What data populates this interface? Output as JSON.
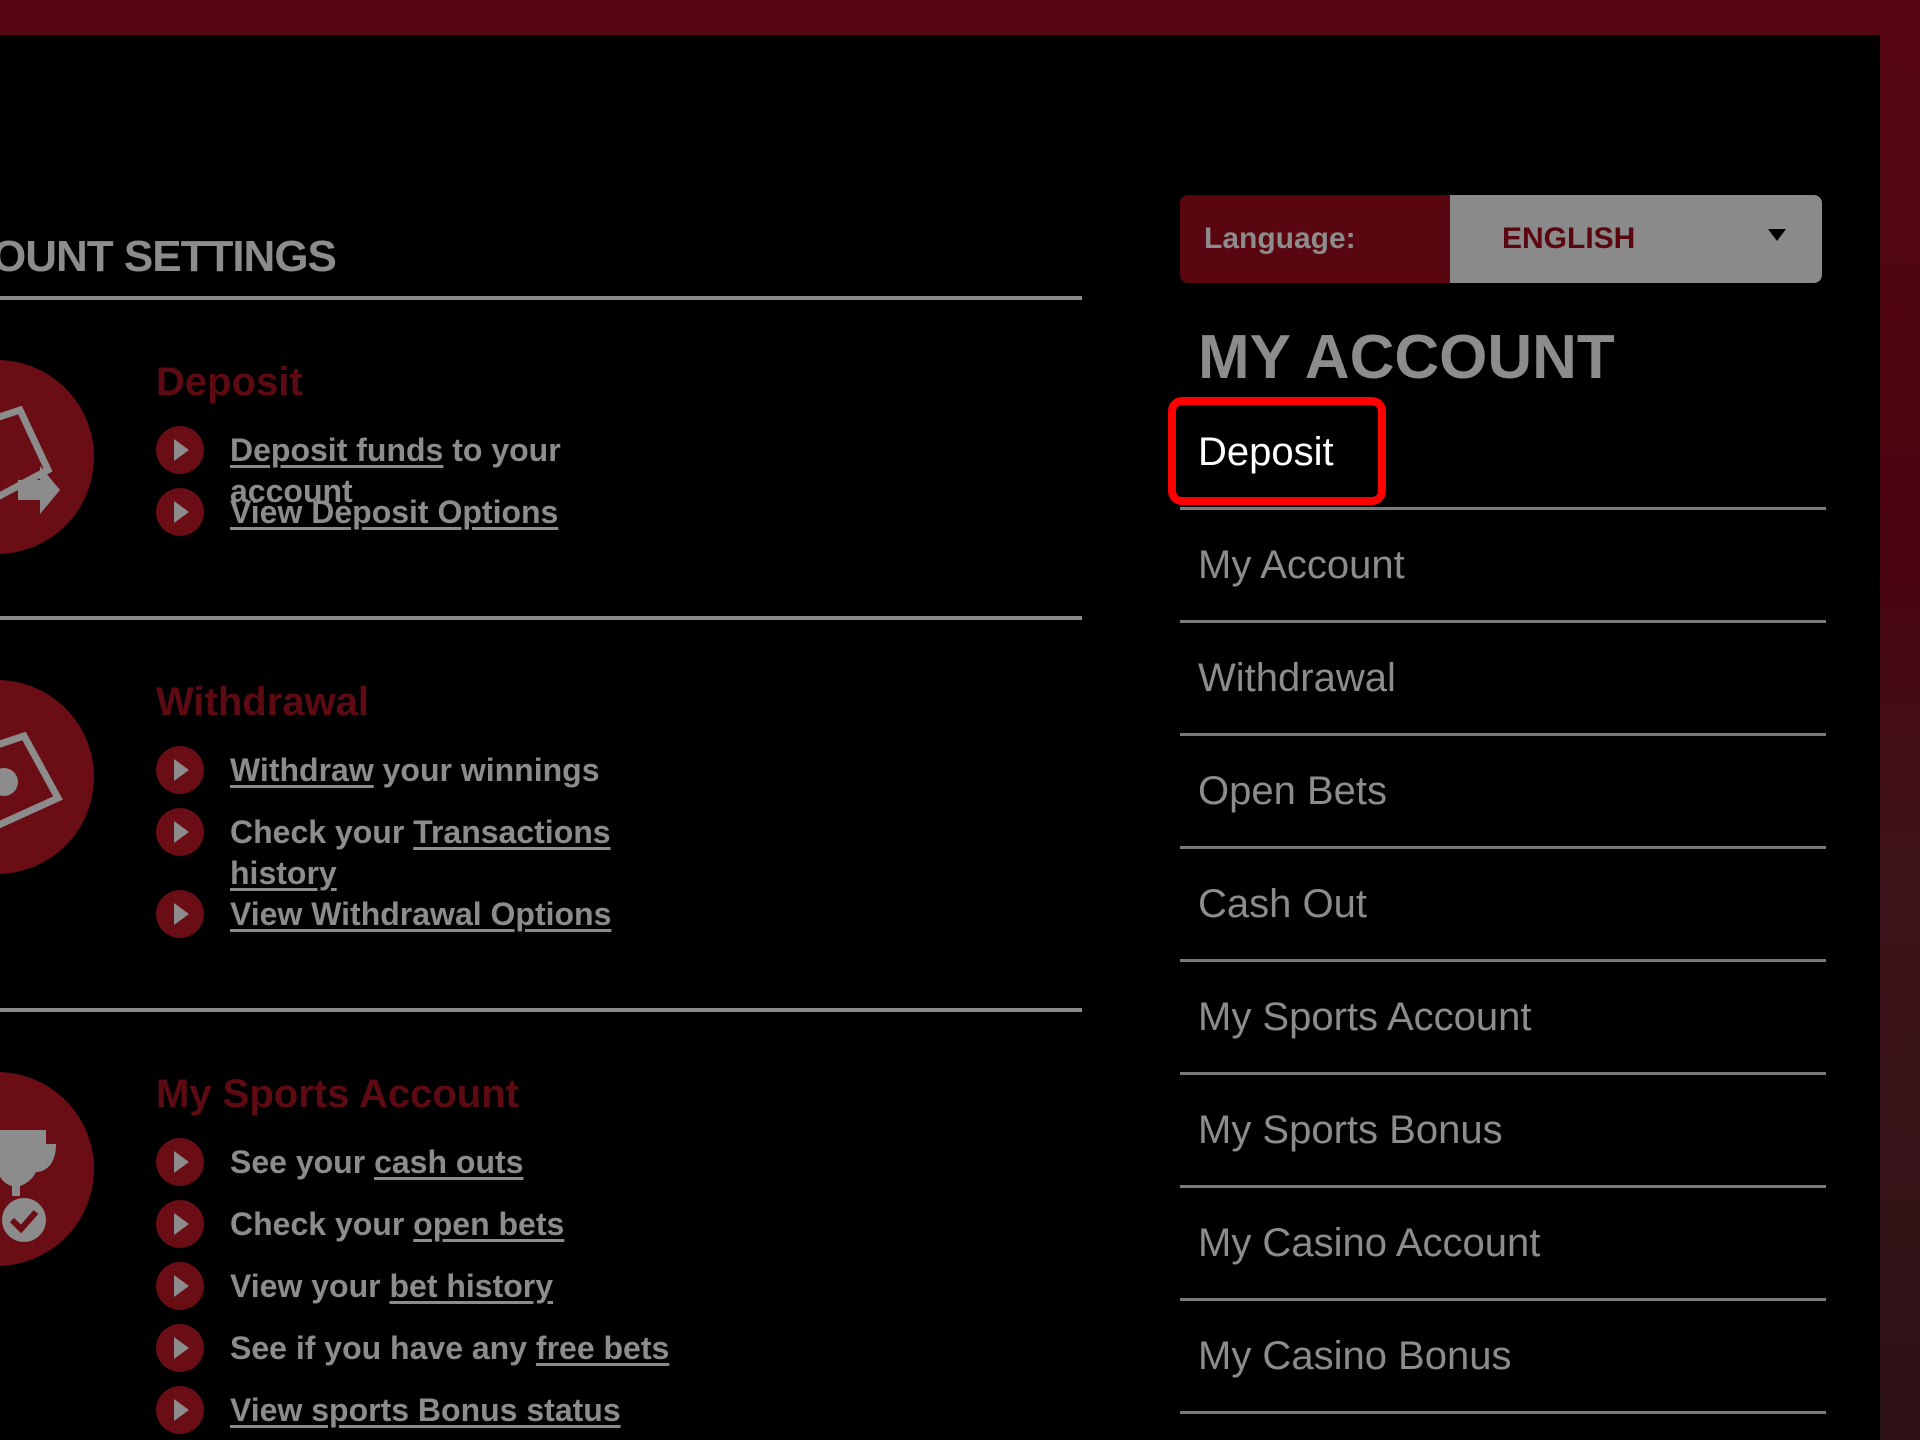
{
  "colors": {
    "brand": "#5a0611",
    "highlight": "#ff0000",
    "text_muted": "#8c8c8c",
    "panel": "#000000"
  },
  "settings": {
    "title": "OUNT SETTINGS",
    "sections": [
      {
        "icon": "money-arrow-icon",
        "title": "Deposit",
        "items": [
          {
            "link": "Deposit funds",
            "text_after": " to your account"
          },
          {
            "link": "View Deposit Options",
            "text_after": ""
          }
        ]
      },
      {
        "icon": "money-bill-icon",
        "title": "Withdrawal",
        "items": [
          {
            "link": "Withdraw",
            "text_after": " your winnings"
          },
          {
            "text_before": "Check your ",
            "link": "Transactions history"
          },
          {
            "link": "View Withdrawal Options",
            "text_after": ""
          }
        ]
      },
      {
        "icon": "trophy-check-icon",
        "title": "My Sports Account",
        "items": [
          {
            "text_before": "See your ",
            "link": "cash outs"
          },
          {
            "text_before": "Check your ",
            "link": "open bets"
          },
          {
            "text_before": "View your ",
            "link": "bet history"
          },
          {
            "text_before": "See if you have any ",
            "link": "free bets"
          },
          {
            "link": "View sports Bonus status",
            "text_after": ""
          }
        ]
      }
    ]
  },
  "language": {
    "label": "Language:",
    "selected": "ENGLISH"
  },
  "account": {
    "title": "MY ACCOUNT",
    "menu": [
      "Deposit",
      "My Account",
      "Withdrawal",
      "Open Bets",
      "Cash Out",
      "My Sports Account",
      "My Sports Bonus",
      "My Casino Account",
      "My Casino Bonus"
    ]
  }
}
